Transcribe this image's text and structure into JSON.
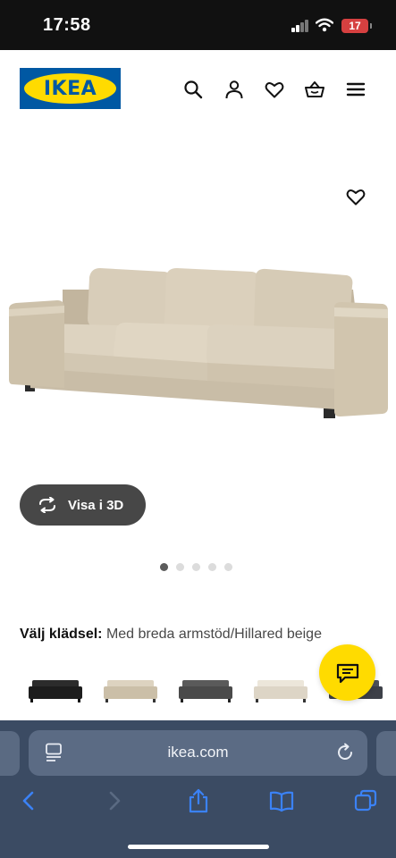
{
  "status_bar": {
    "time": "17:58",
    "battery": "17"
  },
  "header": {
    "logo_text": "IKEA",
    "icons": [
      "search-icon",
      "account-icon",
      "heart-icon",
      "basket-icon",
      "menu-icon"
    ]
  },
  "product": {
    "favorite_icon": "heart-icon",
    "view_3d_label": "Visa i 3D",
    "gallery_count": 5,
    "gallery_active_index": 0
  },
  "fabric": {
    "label": "Välj klädsel:",
    "value": "Med breda armstöd/Hillared beige",
    "swatches": [
      "black",
      "beige",
      "dark grey",
      "light beige",
      "dark grey"
    ]
  },
  "chat": {
    "icon": "chat-icon"
  },
  "safari": {
    "url": "ikea.com",
    "toolbar_icons": [
      "back-icon",
      "forward-icon",
      "share-icon",
      "bookmarks-icon",
      "tabs-icon"
    ]
  },
  "colors": {
    "ikea_blue": "#0058a3",
    "ikea_yellow": "#ffdb00",
    "safari_bar": "#3b4b63",
    "toolbar_tint": "#3b82f6",
    "button_dark": "#474747"
  }
}
